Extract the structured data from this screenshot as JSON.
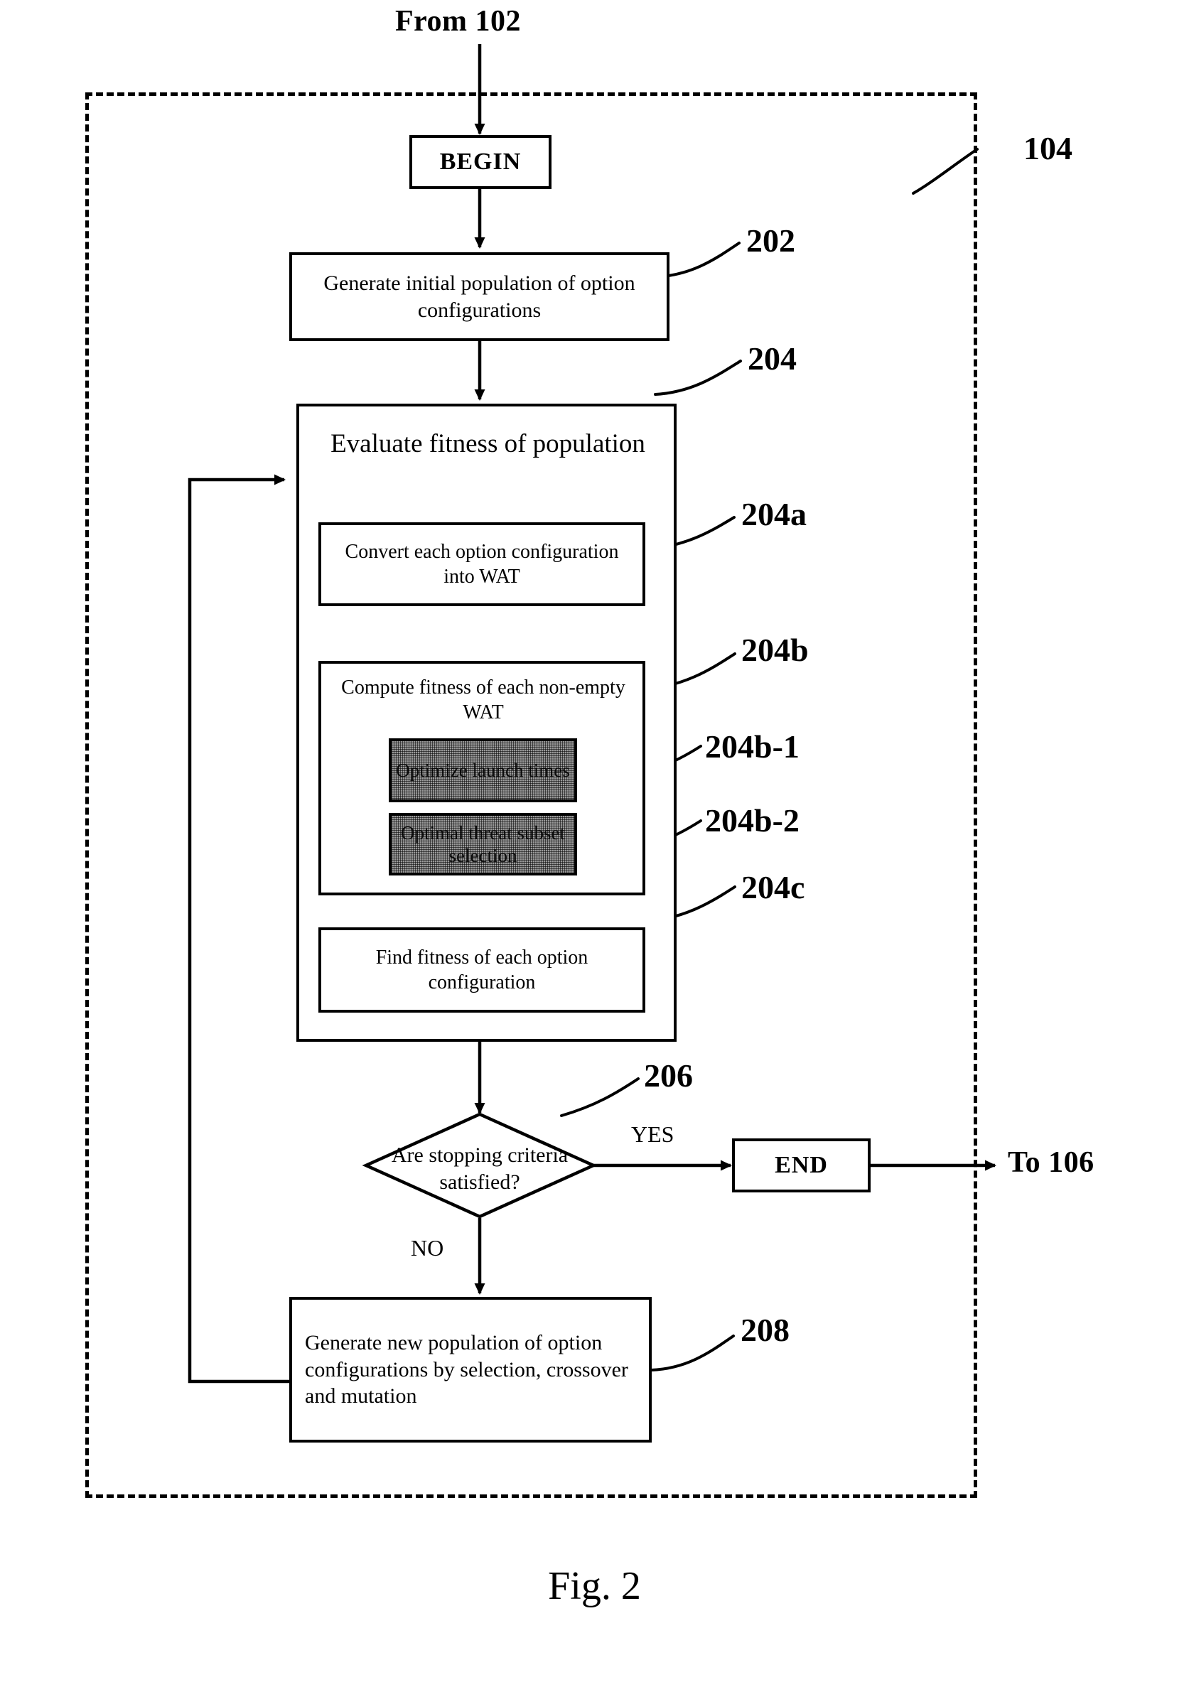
{
  "figure": {
    "caption": "Fig. 2",
    "entry_connector": "From 102",
    "exit_connector": "To 106",
    "group_ref": "104"
  },
  "nodes": {
    "begin": {
      "label": "BEGIN",
      "type": "terminator"
    },
    "end": {
      "label": "END",
      "type": "terminator"
    },
    "step_202": {
      "ref": "202",
      "text": "Generate initial population of option configurations"
    },
    "step_204": {
      "ref": "204",
      "text": "Evaluate fitness of population"
    },
    "step_204a": {
      "ref": "204a",
      "text": "Convert each option configuration into WAT"
    },
    "step_204b": {
      "ref": "204b",
      "text": "Compute fitness of each non-empty WAT"
    },
    "step_204b1": {
      "ref": "204b-1",
      "text": "Optimize launch times",
      "shaded": true
    },
    "step_204b2": {
      "ref": "204b-2",
      "text": "Optimal threat subset selection",
      "shaded": true
    },
    "step_204c": {
      "ref": "204c",
      "text": "Find fitness of each option configuration"
    },
    "decision_206": {
      "ref": "206",
      "text": "Are stopping criteria satisfied?",
      "type": "decision"
    },
    "step_208": {
      "ref": "208",
      "text": "Generate new population of option configurations by selection, crossover and mutation"
    }
  },
  "edges": {
    "yes_label": "YES",
    "no_label": "NO"
  },
  "colors": {
    "stroke": "#000000",
    "background": "#ffffff",
    "shade_fill": "#9a9a9a"
  }
}
